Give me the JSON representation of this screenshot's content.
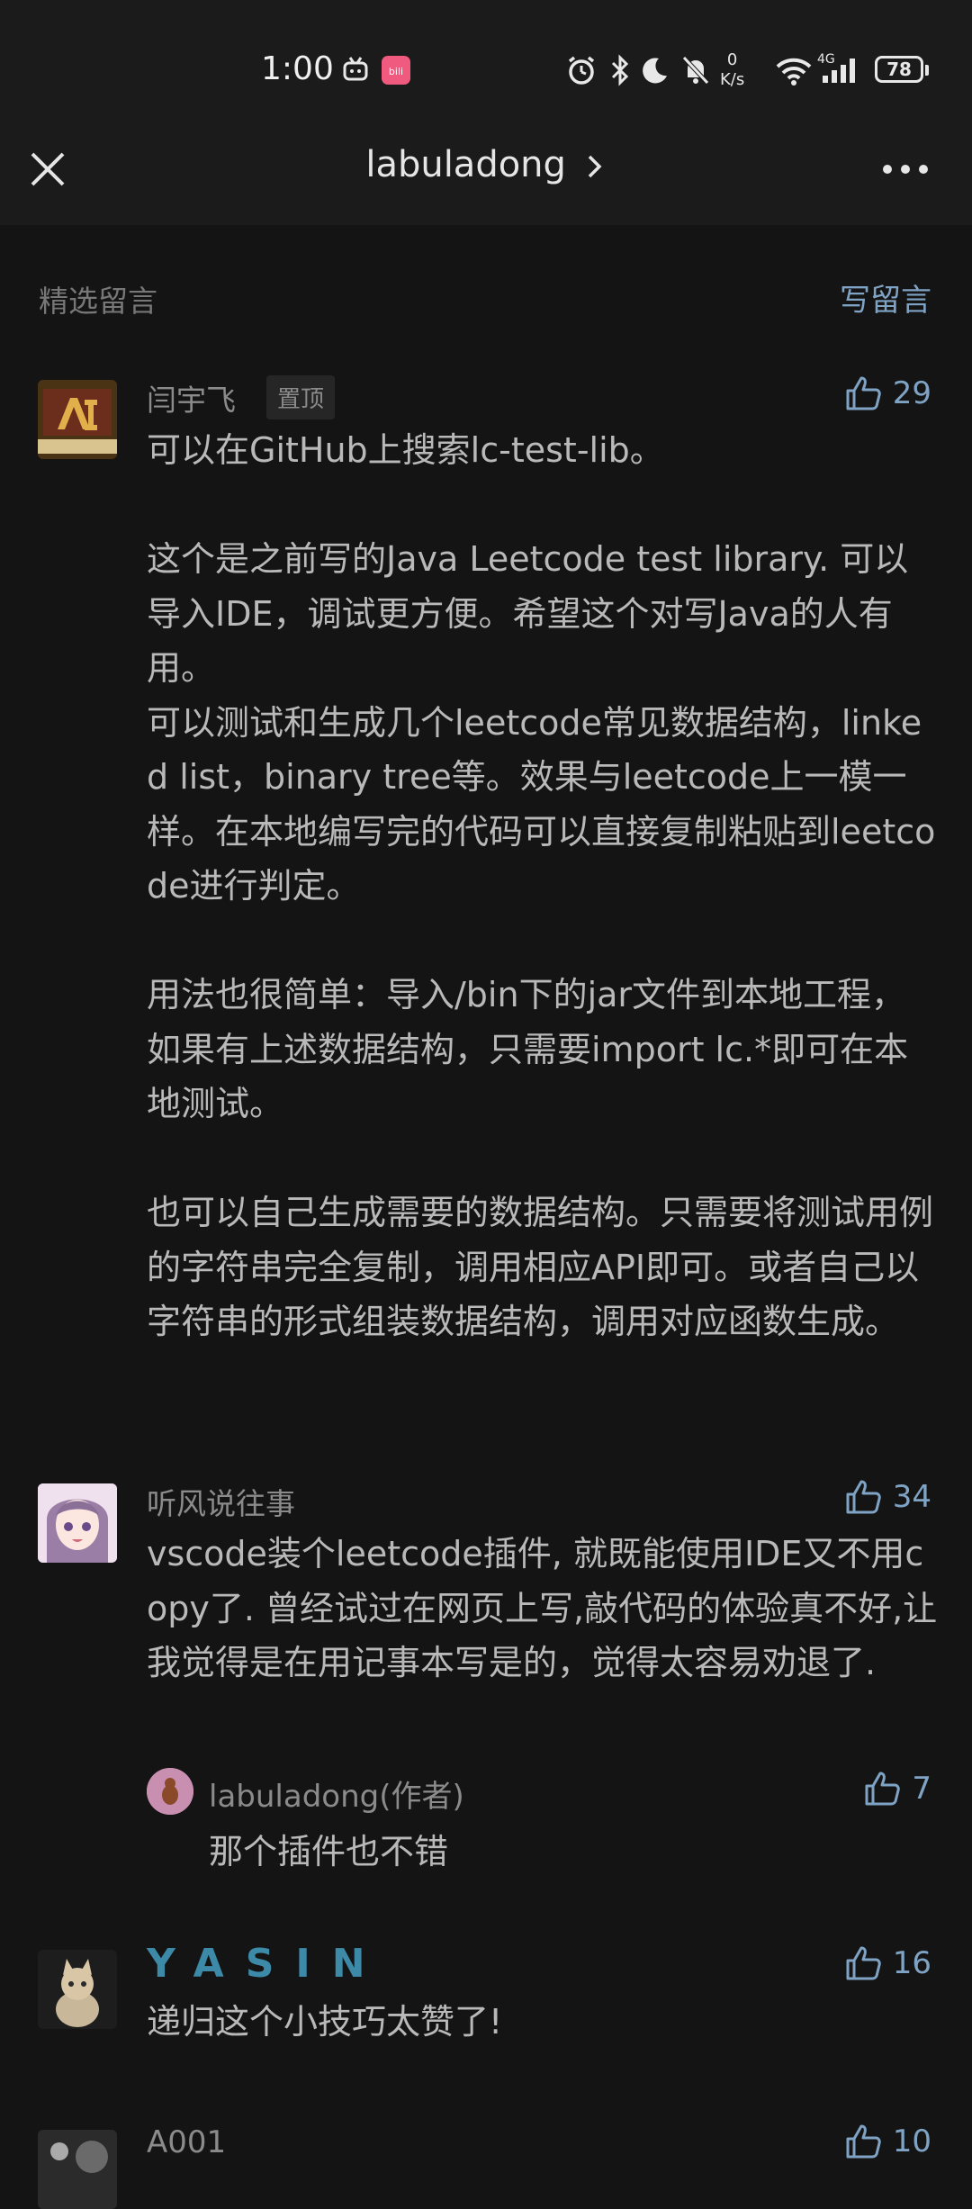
{
  "status_bar": {
    "time": "1:00",
    "net_speed_value": "0",
    "net_speed_unit": "K/s",
    "signal_label": "4G",
    "battery": "78"
  },
  "nav": {
    "title": "labuladong"
  },
  "section": {
    "title": "精选留言",
    "write_label": "写留言"
  },
  "comments": [
    {
      "name": "闫宇飞",
      "pinned": "置顶",
      "likes": "29",
      "text": "可以在GitHub上搜索lc-test-lib。\n\n这个是之前写的Java Leetcode test library. 可以导入IDE，调试更方便。希望这个对写Java的人有用。\n可以测试和生成几个leetcode常见数据结构，linked list，binary tree等。效果与leetcode上一模一样。在本地编写完的代码可以直接复制粘贴到leetcode进行判定。\n\n用法也很简单：导入/bin下的jar文件到本地工程，如果有上述数据结构，只需要import lc.*即可在本地测试。\n\n也可以自己生成需要的数据结构。只需要将测试用例的字符串完全复制，调用相应API即可。或者自己以字符串的形式组装数据结构，调用对应函数生成。"
    },
    {
      "name": "听风说往事",
      "likes": "34",
      "text": "vscode装个leetcode插件, 就既能使用IDE又不用copy了. 曾经试过在网页上写,敲代码的体验真不好,让我觉得是在用记事本写是的，觉得太容易劝退了.",
      "reply": {
        "name": "labuladong(作者)",
        "likes": "7",
        "text": "那个插件也不错"
      }
    },
    {
      "name": "YASIN",
      "likes": "16",
      "text": "递归这个小技巧太赞了!"
    },
    {
      "name": "A001",
      "likes": "10"
    }
  ],
  "colors": {
    "background": "#141414",
    "accent": "#7fa3c4",
    "yasin_name": "#3d8aa8"
  }
}
